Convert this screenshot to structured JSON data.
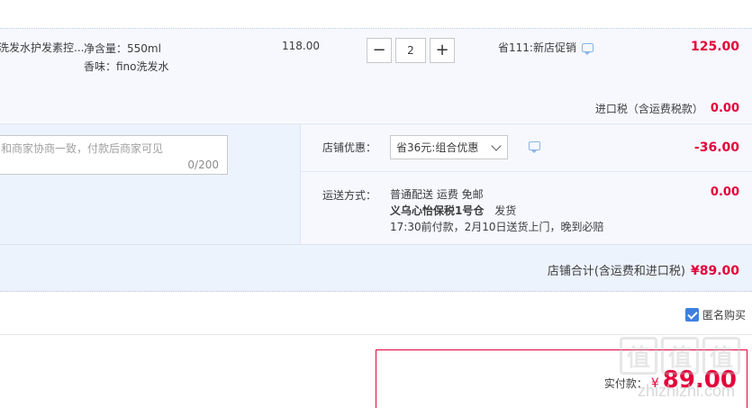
{
  "item": {
    "name": "洗发水护发素控...",
    "sku_lines": [
      "净含量：550ml",
      "香味：fino洗发水"
    ],
    "price": "118.00",
    "quantity": "2",
    "decrease_label": "−",
    "increase_label": "+",
    "promo_text": "省111:新店促销",
    "total": "125.00"
  },
  "tax": {
    "label": "进口税（含运费税款）",
    "value": "0.00"
  },
  "memo": {
    "placeholder": "和商家协商一致，付款后商家可见",
    "count": "0/200"
  },
  "shop_coupon": {
    "label": "店铺优惠：",
    "selected": "省36元:组合优惠",
    "discount": "-36.00"
  },
  "shipping": {
    "label": "运送方式：",
    "line1": "普通配送 运费 免邮",
    "warehouse": "义乌心怡保税1号仓",
    "dispatch": "发货",
    "line3": "17:30前付款，2月10日送货上门，晚到必赔",
    "fee": "0.00"
  },
  "store_total": {
    "label": "店铺合计(含运费和进口税)",
    "value": "¥89.00"
  },
  "anonymous": {
    "label": "匿名购买"
  },
  "payment": {
    "label": "实付款：",
    "currency": "¥",
    "amount": "89.00"
  },
  "watermark": {
    "logo_glyphs": [
      "值",
      "值",
      "值"
    ],
    "text": "zhizhizhi.com"
  },
  "colors": {
    "accent": "#e4003a",
    "checkbox": "#3f7fe0",
    "row_bg": "#f6f8fe",
    "area_bg": "#edf3fd"
  }
}
